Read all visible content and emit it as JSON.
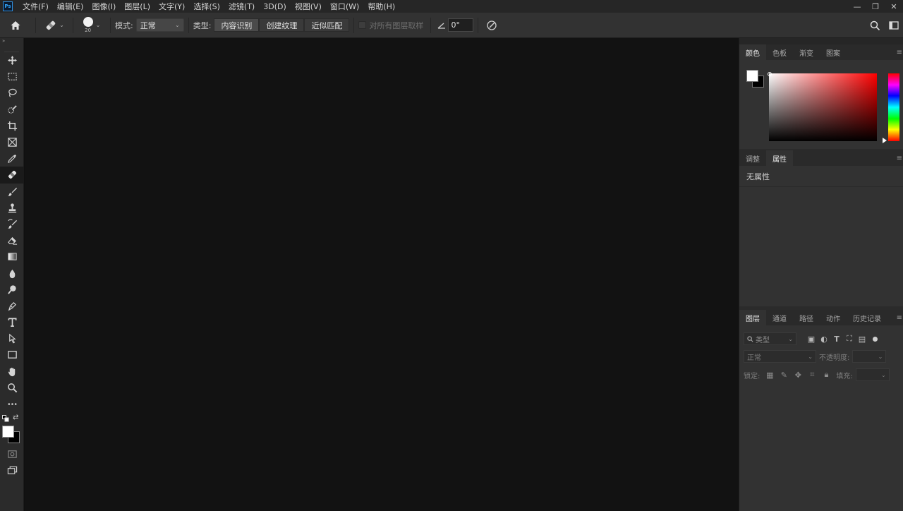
{
  "app": {
    "logo_text": "Ps"
  },
  "menu": [
    "文件(F)",
    "编辑(E)",
    "图像(I)",
    "图层(L)",
    "文字(Y)",
    "选择(S)",
    "滤镜(T)",
    "3D(D)",
    "视图(V)",
    "窗口(W)",
    "帮助(H)"
  ],
  "window_controls": {
    "minimize": "—",
    "restore": "❐",
    "close": "✕"
  },
  "options": {
    "brush_size": "20",
    "mode_label": "模式:",
    "mode_value": "正常",
    "type_label": "类型:",
    "type_buttons": [
      "内容识别",
      "创建纹理",
      "近似匹配"
    ],
    "sample_all_label": "对所有图层取样",
    "angle_value": "0°"
  },
  "icons": {
    "home": "home-icon",
    "healing": "spot-healing-brush-icon",
    "search": "search-icon",
    "workspace": "workspace-icon"
  },
  "colors": {
    "foreground": "#ffffff",
    "background": "#000000",
    "ps_blue": "#31a8ff"
  },
  "panels": {
    "color_tabs": [
      "颜色",
      "色板",
      "渐变",
      "图案"
    ],
    "properties_tabs": [
      "调整",
      "属性"
    ],
    "properties_empty": "无属性",
    "layers_tabs": [
      "图层",
      "通道",
      "路径",
      "动作",
      "历史记录"
    ],
    "layers_search_placeholder": "类型",
    "blend_mode": "正常",
    "opacity_label": "不透明度:",
    "lock_label": "锁定:",
    "fill_label": "填充:"
  }
}
